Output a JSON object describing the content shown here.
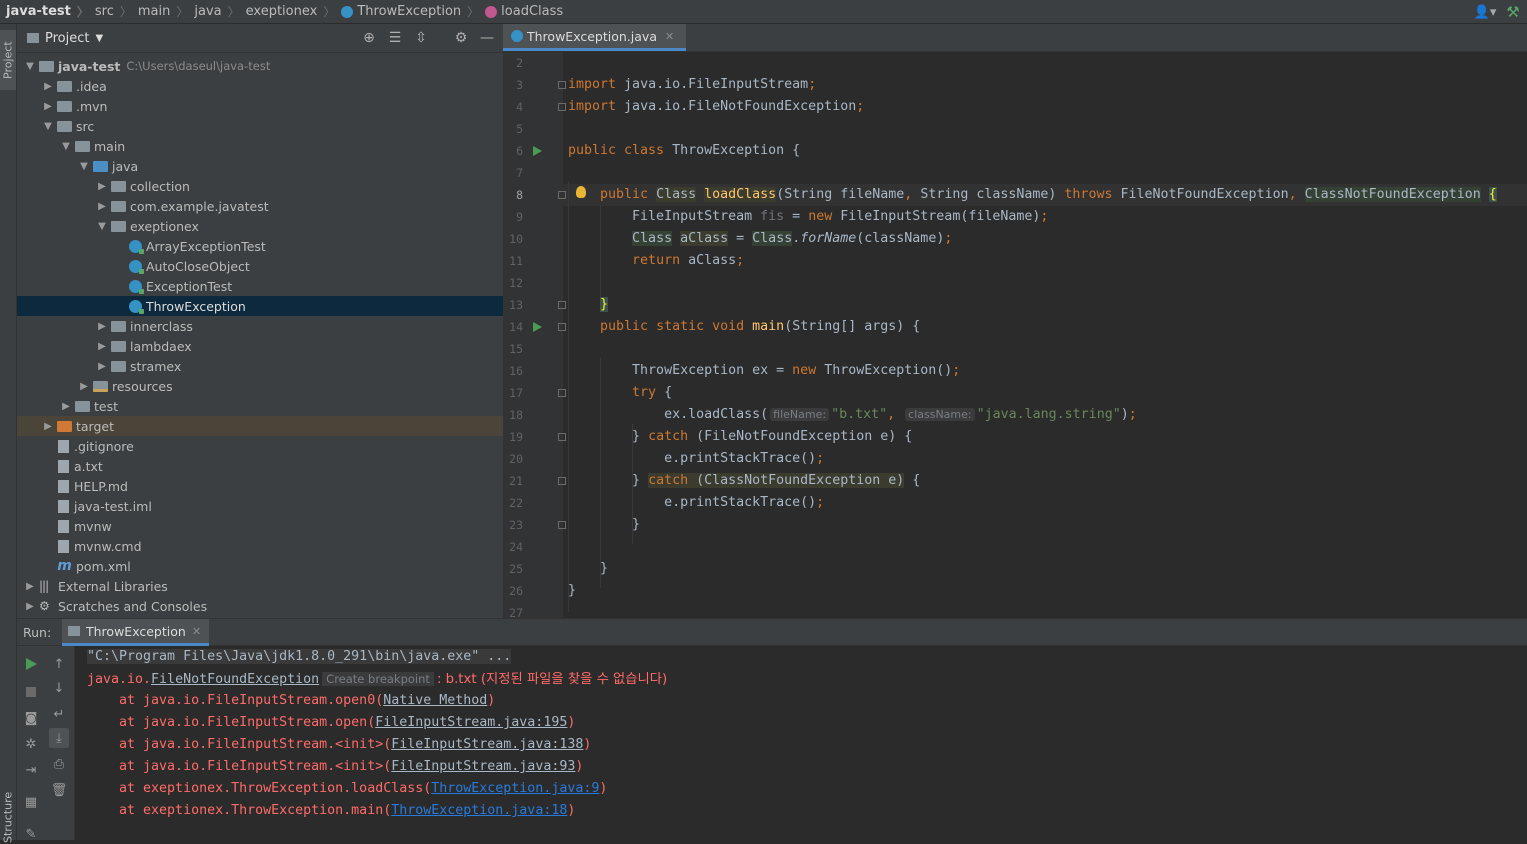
{
  "breadcrumb": [
    "java-test",
    "src",
    "main",
    "java",
    "exeptionex",
    "ThrowException",
    "loadClass"
  ],
  "left_stripe": {
    "project": "Project",
    "structure": "Structure"
  },
  "project_panel": {
    "title": "Project",
    "tree": [
      {
        "label": "java-test",
        "sub": "C:\\Users\\daseul\\java-test",
        "depth": 0,
        "arrow": "open",
        "icon": "folder"
      },
      {
        "label": ".idea",
        "depth": 1,
        "arrow": "closed",
        "icon": "folder"
      },
      {
        "label": ".mvn",
        "depth": 1,
        "arrow": "closed",
        "icon": "folder"
      },
      {
        "label": "src",
        "depth": 1,
        "arrow": "open",
        "icon": "folder"
      },
      {
        "label": "main",
        "depth": 2,
        "arrow": "open",
        "icon": "folder"
      },
      {
        "label": "java",
        "depth": 3,
        "arrow": "open",
        "icon": "folder-blue"
      },
      {
        "label": "collection",
        "depth": 4,
        "arrow": "closed",
        "icon": "folder"
      },
      {
        "label": "com.example.javatest",
        "depth": 4,
        "arrow": "closed",
        "icon": "folder"
      },
      {
        "label": "exeptionex",
        "depth": 4,
        "arrow": "open",
        "icon": "folder"
      },
      {
        "label": "ArrayExceptionTest",
        "depth": 5,
        "arrow": "none",
        "icon": "class"
      },
      {
        "label": "AutoCloseObject",
        "depth": 5,
        "arrow": "none",
        "icon": "class"
      },
      {
        "label": "ExceptionTest",
        "depth": 5,
        "arrow": "none",
        "icon": "class"
      },
      {
        "label": "ThrowException",
        "depth": 5,
        "arrow": "none",
        "icon": "class",
        "selected": true
      },
      {
        "label": "innerclass",
        "depth": 4,
        "arrow": "closed",
        "icon": "folder"
      },
      {
        "label": "lambdaex",
        "depth": 4,
        "arrow": "closed",
        "icon": "folder"
      },
      {
        "label": "stramex",
        "depth": 4,
        "arrow": "closed",
        "icon": "folder"
      },
      {
        "label": "resources",
        "depth": 3,
        "arrow": "closed",
        "icon": "folder-res"
      },
      {
        "label": "test",
        "depth": 2,
        "arrow": "closed",
        "icon": "folder"
      },
      {
        "label": "target",
        "depth": 1,
        "arrow": "closed",
        "icon": "folder-orange",
        "excluded": true
      },
      {
        "label": ".gitignore",
        "depth": 1,
        "arrow": "none",
        "icon": "file"
      },
      {
        "label": "a.txt",
        "depth": 1,
        "arrow": "none",
        "icon": "file"
      },
      {
        "label": "HELP.md",
        "depth": 1,
        "arrow": "none",
        "icon": "file"
      },
      {
        "label": "java-test.iml",
        "depth": 1,
        "arrow": "none",
        "icon": "file"
      },
      {
        "label": "mvnw",
        "depth": 1,
        "arrow": "none",
        "icon": "file"
      },
      {
        "label": "mvnw.cmd",
        "depth": 1,
        "arrow": "none",
        "icon": "file"
      },
      {
        "label": "pom.xml",
        "depth": 1,
        "arrow": "none",
        "icon": "maven"
      },
      {
        "label": "External Libraries",
        "depth": 0,
        "arrow": "closed",
        "icon": "library"
      },
      {
        "label": "Scratches and Consoles",
        "depth": 0,
        "arrow": "closed",
        "icon": "scratch"
      }
    ]
  },
  "editor": {
    "tab": "ThrowException.java",
    "line_numbers": [
      "2",
      "3",
      "4",
      "5",
      "6",
      "7",
      "8",
      "9",
      "10",
      "11",
      "12",
      "13",
      "14",
      "15",
      "16",
      "17",
      "18",
      "19",
      "20",
      "21",
      "22",
      "23",
      "24",
      "25",
      "26",
      "27"
    ],
    "hints": {
      "fileName": "fileName:",
      "className": "className:"
    }
  },
  "run": {
    "label": "Run:",
    "tab": "ThrowException",
    "command": "\"C:\\Program Files\\Java\\jdk1.8.0_291\\bin\\java.exe\" ...",
    "exception_prefix": "java.io.",
    "exception_class": "FileNotFoundException",
    "breakpoint_hint": "Create breakpoint",
    "exception_msg": ": b.txt (지정된 파일을 찾을 수 없습니다)",
    "trace": [
      {
        "at": "    at java.io.FileInputStream.open0(",
        "link": "Native Method",
        "end": ")",
        "blue": false
      },
      {
        "at": "    at java.io.FileInputStream.open(",
        "link": "FileInputStream.java:195",
        "end": ")",
        "blue": false
      },
      {
        "at": "    at java.io.FileInputStream.<init>(",
        "link": "FileInputStream.java:138",
        "end": ")",
        "blue": false
      },
      {
        "at": "    at java.io.FileInputStream.<init>(",
        "link": "FileInputStream.java:93",
        "end": ")",
        "blue": false
      },
      {
        "at": "    at exeptionex.ThrowException.loadClass(",
        "link": "ThrowException.java:9",
        "end": ")",
        "blue": true
      },
      {
        "at": "    at exeptionex.ThrowException.main(",
        "link": "ThrowException.java:18",
        "end": ")",
        "blue": true
      }
    ]
  }
}
